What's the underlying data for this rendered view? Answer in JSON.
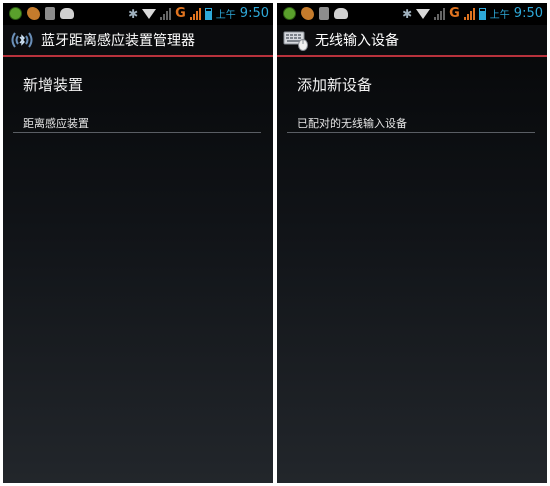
{
  "left_screen": {
    "status_bar": {
      "ampm": "上午",
      "time": "9:50",
      "network": "G"
    },
    "action_bar": {
      "title": "蓝牙距离感应装置管理器"
    },
    "content": {
      "add_item": "新增装置",
      "section_header": "距离感应装置"
    }
  },
  "right_screen": {
    "status_bar": {
      "ampm": "上午",
      "time": "9:50",
      "network": "G"
    },
    "action_bar": {
      "title": "无线输入设备"
    },
    "content": {
      "add_item": "添加新设备",
      "section_header": "已配对的无线输入设备"
    }
  },
  "icons": {
    "left_app_icon": "bluetooth-proximity-icon",
    "right_app_icon": "wireless-input-devices-icon"
  },
  "colors": {
    "accent": "#b8323c",
    "status_text": "#2ea8d8",
    "signal": "#e0731f"
  }
}
